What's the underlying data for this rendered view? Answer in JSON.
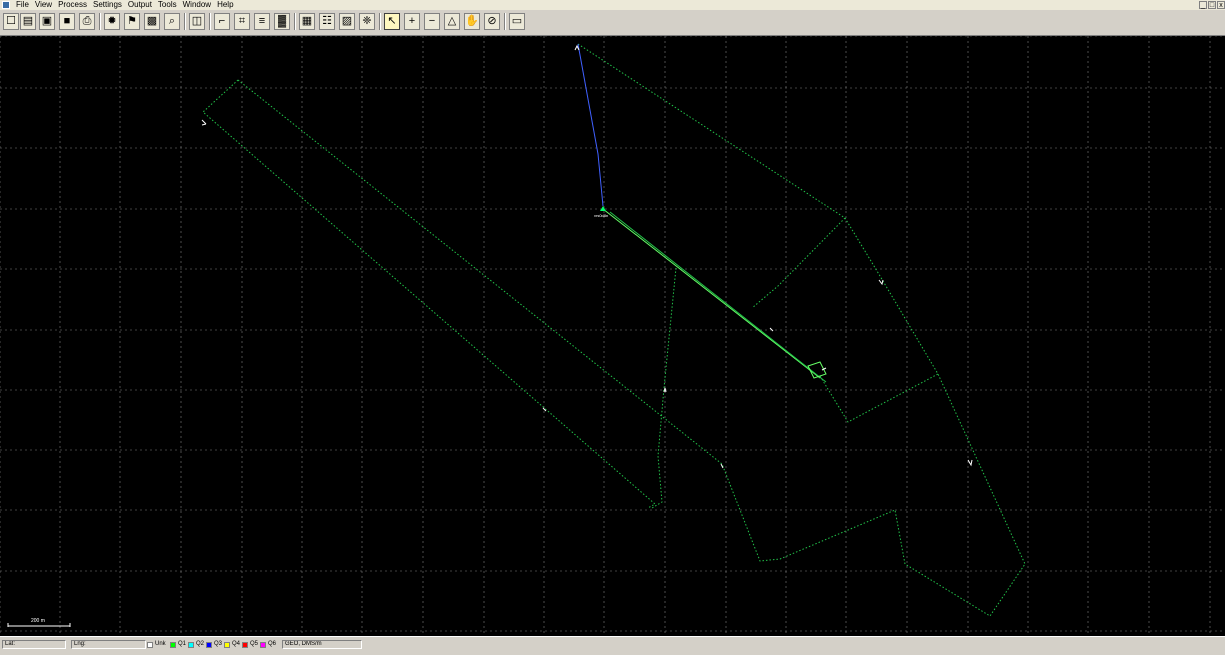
{
  "menu": {
    "items": [
      "File",
      "View",
      "Process",
      "Settings",
      "Output",
      "Tools",
      "Window",
      "Help"
    ]
  },
  "window_controls": [
    "_",
    "□",
    "x"
  ],
  "toolbar": {
    "buttons": [
      {
        "name": "new-doc-icon",
        "glyph": "☐"
      },
      {
        "name": "open-doc-icon",
        "glyph": "▤"
      },
      {
        "name": "open-folder-icon",
        "glyph": "▣"
      },
      {
        "name": "save-icon",
        "glyph": "■"
      },
      {
        "name": "print-icon",
        "glyph": "⎙"
      },
      {
        "name": "process-icon",
        "glyph": "✹"
      },
      {
        "name": "process-flag-icon",
        "glyph": "⚑"
      },
      {
        "name": "settings-map-icon",
        "glyph": "▩"
      },
      {
        "name": "find-icon",
        "glyph": "⌕"
      },
      {
        "name": "toggle-view-icon",
        "glyph": "◫"
      },
      {
        "name": "plot-icon",
        "glyph": "⌐"
      },
      {
        "name": "plot-grid-icon",
        "glyph": "⌗"
      },
      {
        "name": "list-icon",
        "glyph": "≡"
      },
      {
        "name": "chart-icon",
        "glyph": "▓"
      },
      {
        "name": "map-layout-icon",
        "glyph": "▦"
      },
      {
        "name": "table-icon",
        "glyph": "☷"
      },
      {
        "name": "save-output-icon",
        "glyph": "▨"
      },
      {
        "name": "network-icon",
        "glyph": "❈"
      },
      {
        "name": "pointer-icon",
        "glyph": "↖"
      },
      {
        "name": "zoom-in-icon",
        "glyph": "+"
      },
      {
        "name": "zoom-out-icon",
        "glyph": "−"
      },
      {
        "name": "measure-icon",
        "glyph": "△"
      },
      {
        "name": "pan-hand-icon",
        "glyph": "✋"
      },
      {
        "name": "stop-icon",
        "glyph": "⊘"
      },
      {
        "name": "window-icon",
        "glyph": "▭"
      }
    ]
  },
  "map": {
    "base_station_label": "vrs0d8n",
    "scale_bar_label": "200 m",
    "colors": {
      "background": "#000000",
      "grid": "#808080",
      "track": "#22c34a",
      "track_bright": "#66ff66",
      "track_blue": "#4060ff",
      "marker": "#ffffff",
      "base": "#00ff66"
    }
  },
  "status": {
    "lat_label": "Lat:",
    "lat_value": "",
    "lng_label": "Lng:",
    "lng_value": "",
    "quality": [
      {
        "label": "Unk",
        "color": "#ffffff"
      },
      {
        "label": "Q1",
        "color": "#00ff00"
      },
      {
        "label": "Q2",
        "color": "#00ffff"
      },
      {
        "label": "Q3",
        "color": "#0000ff"
      },
      {
        "label": "Q4",
        "color": "#ffff00"
      },
      {
        "label": "Q5",
        "color": "#ff0000"
      },
      {
        "label": "Q6",
        "color": "#ff00ff"
      }
    ],
    "coord_system": "GEO, DMS/m"
  }
}
